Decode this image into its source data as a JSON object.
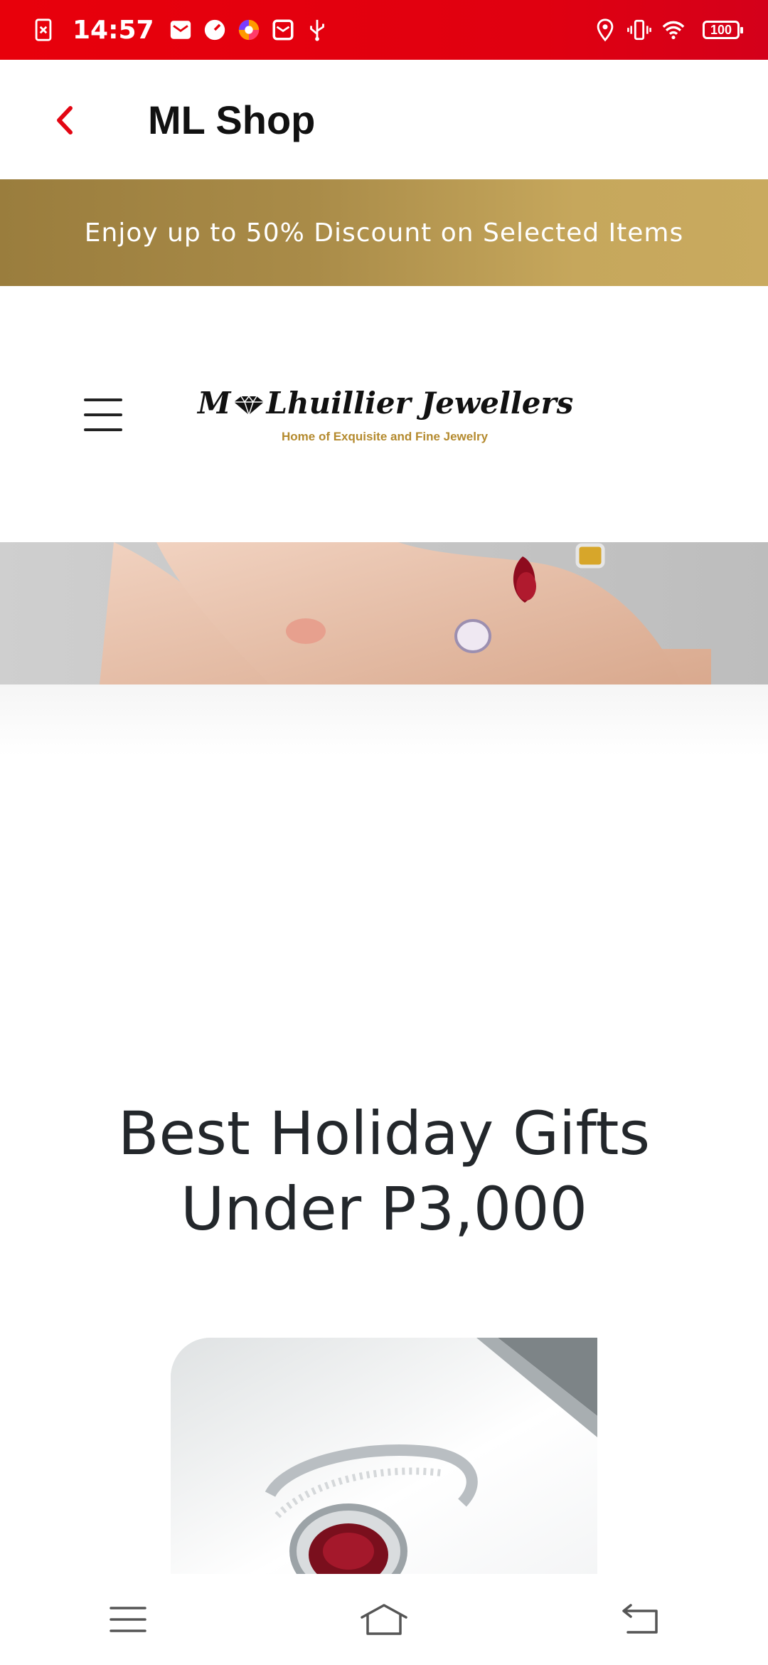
{
  "status_bar": {
    "time": "14:57",
    "battery": "100",
    "left_icons": [
      "sim-error-icon",
      "mail-icon",
      "speed-icon",
      "browser-icon",
      "inbox-icon",
      "usb-icon"
    ],
    "right_icons": [
      "location-icon",
      "vibrate-icon",
      "wifi-icon"
    ]
  },
  "appbar": {
    "title": "ML Shop",
    "back_icon": "chevron-left-icon",
    "accent": "#e30613"
  },
  "promo": {
    "text": "Enjoy up to 50% Discount on Selected Items"
  },
  "site_header": {
    "menu_icon": "hamburger-menu-icon",
    "logo_text": "M Lhuillier Jewellers",
    "logo_tagline": "Home of Exquisite and Fine Jewelry"
  },
  "main": {
    "section_title": "Best Holiday Gifts Under P3,000"
  },
  "navbar": {
    "items": [
      "menu-icon",
      "home-icon",
      "back-icon"
    ]
  },
  "colors": {
    "status_bar": "#e8000b",
    "promo_gold": "#b0924e",
    "logo_gold": "#b48a2e"
  }
}
